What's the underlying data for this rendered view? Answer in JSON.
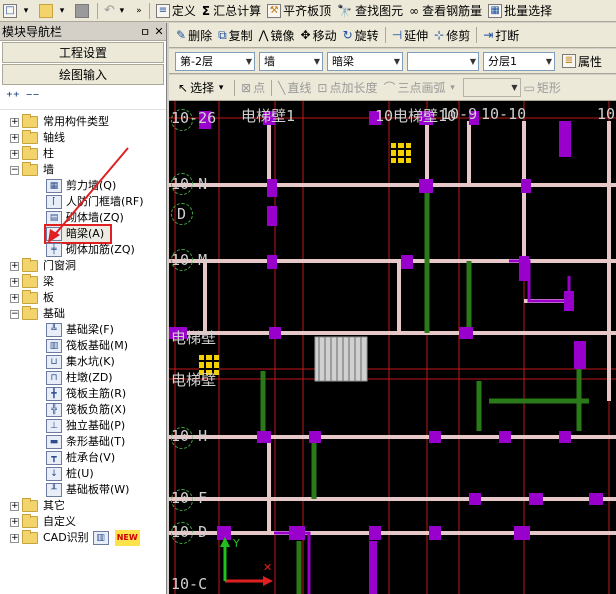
{
  "toolbar": {
    "define": "定义",
    "sum_calc": "汇总计算",
    "align_top": "平齐板顶",
    "find_element": "查找图元",
    "view_rebar": "查看钢筋量",
    "batch_select": "批量选择"
  },
  "panel": {
    "title": "模块导航栏",
    "project_settings": "工程设置",
    "drawing_input": "绘图输入"
  },
  "tree": {
    "common_types": "常用构件类型",
    "axis": "轴线",
    "column": "柱",
    "wall": "墙",
    "wall_children": [
      "剪力墙(Q)",
      "人防门框墙(RF)",
      "砌体墙(ZQ)",
      "暗梁(A)",
      "砌体加筋(ZQ)"
    ],
    "door_window": "门窗洞",
    "beam": "梁",
    "slab": "板",
    "foundation": "基础",
    "foundation_children": [
      "基础梁(F)",
      "筏板基础(M)",
      "集水坑(K)",
      "柱墩(ZD)",
      "筏板主筋(R)",
      "筏板负筋(X)",
      "独立基础(P)",
      "条形基础(T)",
      "桩承台(V)",
      "桩(U)",
      "基础板带(W)"
    ],
    "other": "其它",
    "custom": "自定义",
    "cad_recognition": "CAD识别",
    "new_badge": "NEW"
  },
  "edit_toolbar": {
    "delete": "删除",
    "copy": "复制",
    "mirror": "镜像",
    "move": "移动",
    "rotate": "旋转",
    "extend": "延伸",
    "trim": "修剪",
    "break": "打断"
  },
  "filter_toolbar": {
    "floor": "第-2层",
    "category": "墙",
    "type": "暗梁",
    "element": "",
    "layer": "分层1",
    "properties": "属性"
  },
  "draw_toolbar": {
    "select": "选择",
    "point": "点",
    "line": "直线",
    "point_length": "点加长度",
    "three_point_arc": "三点画弧",
    "rect": "矩形"
  },
  "canvas": {
    "labels": [
      "10-26",
      "电梯壁1",
      "10电梯壁10",
      "10-9",
      "10-10",
      "10",
      "10-N",
      "D",
      "10-M",
      "电梯壁",
      "电梯壁",
      "10-H",
      "10-F",
      "10-D",
      "10-C"
    ],
    "axis_x_color": "#e02020",
    "axis_y_color": "#20c020",
    "wall_color": "#9900cc",
    "beam_color": "#e0c0c0",
    "green_beam_color": "#2a7a1a"
  }
}
